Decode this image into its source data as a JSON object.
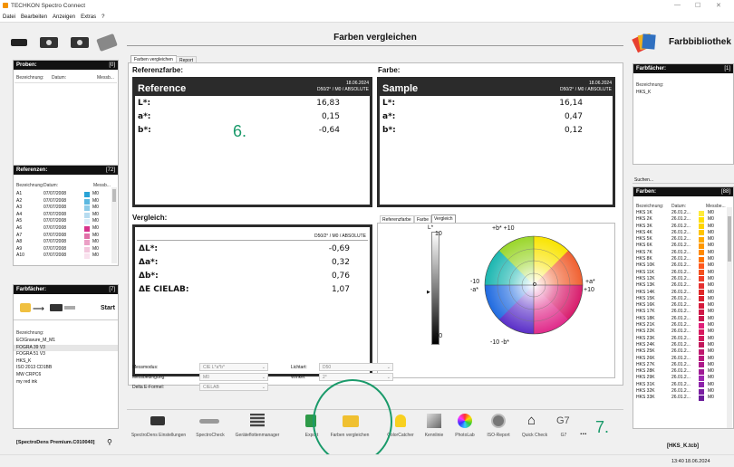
{
  "window": {
    "title": "TECHKON Spectro Connect",
    "min": "—",
    "max": "☐",
    "close": "✕"
  },
  "menu": [
    "Datei",
    "Bearbeiten",
    "Anzeigen",
    "Extras",
    "?"
  ],
  "left": {
    "proben": {
      "title": "Proben:",
      "count": "[0]",
      "cols": [
        "Bezeichnung:",
        "Datum:",
        "Messb..."
      ]
    },
    "referenzen": {
      "title": "Referenzen:",
      "count": "[72]",
      "cols": [
        "Bezeichnung:",
        "Datum:",
        "Messb..."
      ],
      "rows": [
        {
          "name": "A1",
          "date": "07/07/2008",
          "color": "#29a3d6",
          "mode": "M0"
        },
        {
          "name": "A2",
          "date": "07/07/2008",
          "color": "#5bb8e0",
          "mode": "M0"
        },
        {
          "name": "A3",
          "date": "07/07/2008",
          "color": "#8ccbe8",
          "mode": "M0"
        },
        {
          "name": "A4",
          "date": "07/07/2008",
          "color": "#b7dcf0",
          "mode": "M0"
        },
        {
          "name": "A5",
          "date": "07/07/2008",
          "color": "#d9ecf7",
          "mode": "M0"
        },
        {
          "name": "A6",
          "date": "07/07/2008",
          "color": "#d6338c",
          "mode": "M0"
        },
        {
          "name": "A7",
          "date": "07/07/2008",
          "color": "#e070a8",
          "mode": "M0"
        },
        {
          "name": "A8",
          "date": "07/07/2008",
          "color": "#eba0c6",
          "mode": "M0"
        },
        {
          "name": "A9",
          "date": "07/07/2008",
          "color": "#f3c7dd",
          "mode": "M0"
        },
        {
          "name": "A10",
          "date": "07/07/2008",
          "color": "#f9e1ee",
          "mode": "M0"
        }
      ]
    },
    "farbfaecher": {
      "title": "Farbfächer:",
      "count": "[7]",
      "start": "Start",
      "label": "Bezeichnung:",
      "items": [
        "ECIGravure_M_M1",
        "FOGRA 39 V3",
        "FOGRA 51 V3",
        "HKS_K",
        "ISO 2013 CD1BB",
        "MW CRPC6",
        "my red ink"
      ]
    },
    "license": "[SpectroDens Premium.C010040]",
    "plug_icon": "⚲"
  },
  "center": {
    "title": "Farben vergleichen",
    "tabs": [
      "Farben vergleichen",
      "Report"
    ],
    "referenz": {
      "label": "Referenzfarbe:",
      "name": "Reference",
      "date": "18.06.2024",
      "cond": "D50/2° / M0 / ABSOLUTE",
      "L": "16,83",
      "a": "0,15",
      "b": "-0,64"
    },
    "farbe": {
      "label": "Farbe:",
      "name": "Sample",
      "date": "18.06.2024",
      "cond": "D50/2° / M0 / ABSOLUTE",
      "L": "16,14",
      "a": "0,47",
      "b": "0,12"
    },
    "labels": {
      "L": "L*:",
      "a": "a*:",
      "b": "b*:"
    },
    "annot6": "6.",
    "vergleich": {
      "label": "Vergleich:",
      "cond": "D50/2° / M0 / ABSOLUTE",
      "dL_label": "ΔL*:",
      "dL": "-0,69",
      "da_label": "Δa*:",
      "da": "0,32",
      "db_label": "Δb*:",
      "db": "0,76",
      "dE_label": "ΔE CIELAB:",
      "dE": "1,07"
    },
    "graph_tabs": [
      "Referenzfarbe",
      "Farbe",
      "Vergleich"
    ],
    "graph": {
      "L_top": "L*",
      "L_10": "10",
      "L_m10": "-10",
      "b_plus": "+b* +10",
      "b_minus": "-10 -b*",
      "a_minus_1": "-10",
      "a_minus_2": "-a*",
      "a_plus_1": "+a*",
      "a_plus_2": "+10"
    },
    "settings": {
      "messmodus": {
        "label": "Messmodus:",
        "value": "CIE L*a*b*"
      },
      "messbedingung": {
        "label": "Messbedingung:",
        "value": "M0"
      },
      "deltae": {
        "label": "Delta E-Formel:",
        "value": "CIELAB"
      },
      "lichtart": {
        "label": "Lichtart:",
        "value": "D50"
      },
      "winkel": {
        "label": "Winkel:",
        "value": "2°"
      }
    },
    "toolbar": [
      "SpectroDens Einstellungen",
      "SpectroCheck",
      "Geräteflottenmanager",
      "Export",
      "Farben vergleichen",
      "ColorCatcher",
      "Kennlinie",
      "PhotoLab",
      "ISO-Report",
      "Quick Check",
      "G7",
      "..."
    ],
    "g7_text": "G7",
    "annot7": "7."
  },
  "right": {
    "title": "Farbbibliothek",
    "farbfaecher": {
      "title": "Farbfächer:",
      "count": "[1]",
      "label": "Bezeichnung:",
      "item": "HKS_K"
    },
    "search_label": "Suchen...",
    "farben": {
      "title": "Farben:",
      "count": "[88]",
      "cols": [
        "Bezeichnung:",
        "Datum:",
        "Messbe..."
      ],
      "rows": [
        {
          "name": "HKS 1K",
          "date": "26.01.2...",
          "color": "#ffeb3b",
          "mode": "M0"
        },
        {
          "name": "HKS 2K",
          "date": "26.01.2...",
          "color": "#ffe000",
          "mode": "M0"
        },
        {
          "name": "HKS 3K",
          "date": "26.01.2...",
          "color": "#ffd400",
          "mode": "M0"
        },
        {
          "name": "HKS 4K",
          "date": "26.01.2...",
          "color": "#ffc400",
          "mode": "M0"
        },
        {
          "name": "HKS 5K",
          "date": "26.01.2...",
          "color": "#ffaa00",
          "mode": "M0"
        },
        {
          "name": "HKS 6K",
          "date": "26.01.2...",
          "color": "#ff9800",
          "mode": "M0"
        },
        {
          "name": "HKS 7K",
          "date": "26.01.2...",
          "color": "#ff8a00",
          "mode": "M0"
        },
        {
          "name": "HKS 8K",
          "date": "26.01.2...",
          "color": "#ff7300",
          "mode": "M0"
        },
        {
          "name": "HKS 10K",
          "date": "26.01.2...",
          "color": "#ff5a1f",
          "mode": "M0"
        },
        {
          "name": "HKS 11K",
          "date": "26.01.2...",
          "color": "#f4511e",
          "mode": "M0"
        },
        {
          "name": "HKS 12K",
          "date": "26.01.2...",
          "color": "#ef3e2a",
          "mode": "M0"
        },
        {
          "name": "HKS 13K",
          "date": "26.01.2...",
          "color": "#e53030",
          "mode": "M0"
        },
        {
          "name": "HKS 14K",
          "date": "26.01.2...",
          "color": "#e02828",
          "mode": "M0"
        },
        {
          "name": "HKS 15K",
          "date": "26.01.2...",
          "color": "#d92030",
          "mode": "M0"
        },
        {
          "name": "HKS 16K",
          "date": "26.01.2...",
          "color": "#d61a3c",
          "mode": "M0"
        },
        {
          "name": "HKS 17K",
          "date": "26.01.2...",
          "color": "#d01848",
          "mode": "M0"
        },
        {
          "name": "HKS 18K",
          "date": "26.01.2...",
          "color": "#c8164e",
          "mode": "M0"
        },
        {
          "name": "HKS 21K",
          "date": "26.01.2...",
          "color": "#e0207a",
          "mode": "M0"
        },
        {
          "name": "HKS 22K",
          "date": "26.01.2...",
          "color": "#d81b60",
          "mode": "M0"
        },
        {
          "name": "HKS 23K",
          "date": "26.01.2...",
          "color": "#d0195c",
          "mode": "M0"
        },
        {
          "name": "HKS 24K",
          "date": "26.01.2...",
          "color": "#c2185b",
          "mode": "M0"
        },
        {
          "name": "HKS 25K",
          "date": "26.01.2...",
          "color": "#c01a70",
          "mode": "M0"
        },
        {
          "name": "HKS 26K",
          "date": "26.01.2...",
          "color": "#b8187c",
          "mode": "M0"
        },
        {
          "name": "HKS 27K",
          "date": "26.01.2...",
          "color": "#ad1a8a",
          "mode": "M0"
        },
        {
          "name": "HKS 28K",
          "date": "26.01.2...",
          "color": "#a01c96",
          "mode": "M0"
        },
        {
          "name": "HKS 29K",
          "date": "26.01.2...",
          "color": "#9c27b0",
          "mode": "M0"
        },
        {
          "name": "HKS 31K",
          "date": "26.01.2...",
          "color": "#8e24aa",
          "mode": "M0"
        },
        {
          "name": "HKS 32K",
          "date": "26.01.2...",
          "color": "#7b1fa2",
          "mode": "M0"
        },
        {
          "name": "HKS 33K",
          "date": "26.01.2...",
          "color": "#6a1b9a",
          "mode": "M0"
        }
      ]
    },
    "status": "[HKS_K.tcb]"
  },
  "statusbar": {
    "time": "13:40",
    "date": "18.06.2024"
  }
}
